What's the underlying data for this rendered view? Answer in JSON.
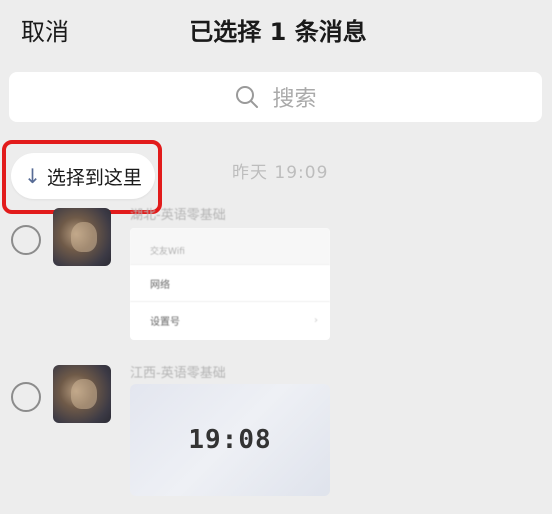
{
  "topbar": {
    "cancel_label": "取消",
    "title": "已选择 1 条消息"
  },
  "search": {
    "icon": "search-icon",
    "placeholder": "搜索"
  },
  "timestamp": "昨天 19:09",
  "select_here": {
    "icon": "arrow-down-icon",
    "label": "选择到这里",
    "highlight_color": "#e21b1b"
  },
  "messages": [
    {
      "sender": "湖北-英语零基础",
      "selected": false,
      "card": {
        "header": "交友Wifi",
        "rows": [
          "网络",
          "设置号"
        ]
      }
    },
    {
      "sender": "江西-英语零基础",
      "selected": false,
      "card": {
        "clock_text": "19:08"
      }
    }
  ]
}
